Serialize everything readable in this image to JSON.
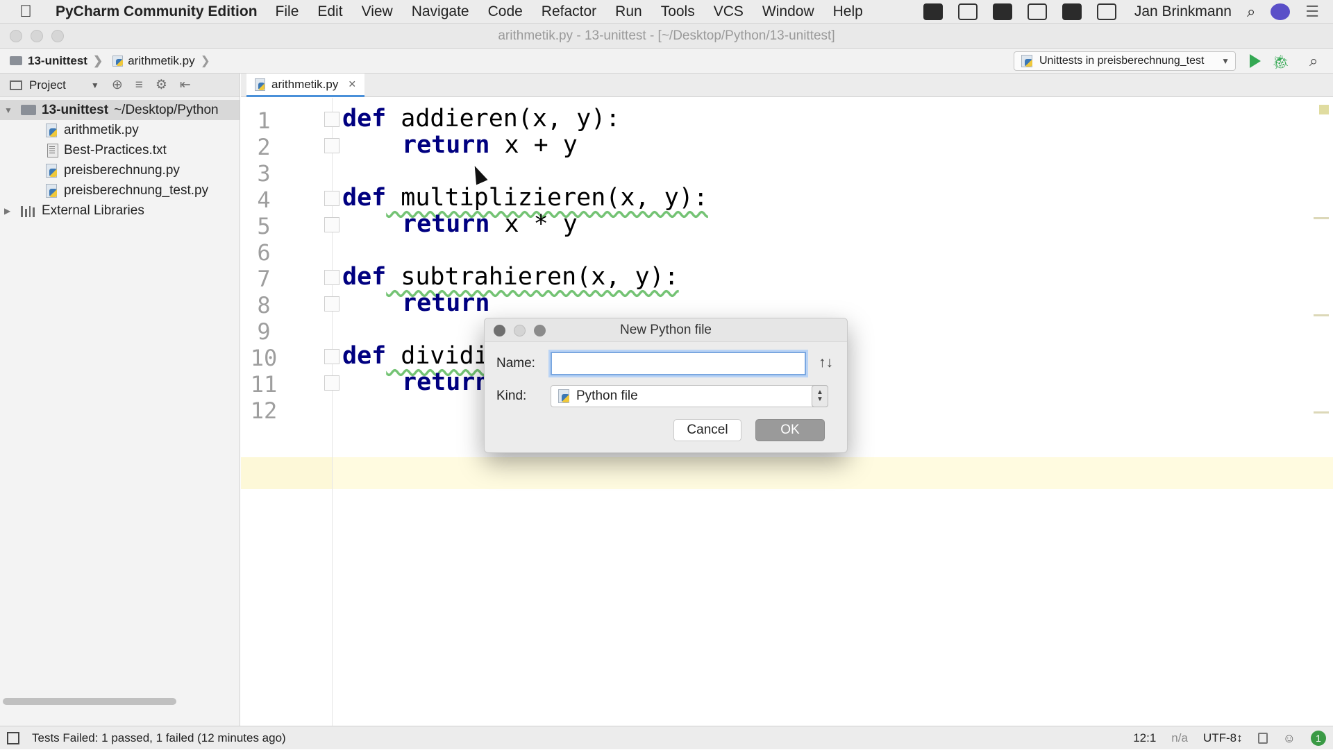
{
  "menubar": {
    "app_name": "PyCharm Community Edition",
    "items": [
      "File",
      "Edit",
      "View",
      "Navigate",
      "Code",
      "Refactor",
      "Run",
      "Tools",
      "VCS",
      "Window",
      "Help"
    ],
    "user": "Jan Brinkmann"
  },
  "window": {
    "title": "arithmetik.py - 13-unittest - [~/Desktop/Python/13-unittest]"
  },
  "navbar": {
    "breadcrumb_project": "13-unittest",
    "breadcrumb_file": "arithmetik.py",
    "run_config": "Unittests in preisberechnung_test"
  },
  "project_panel": {
    "header": "Project",
    "root_name": "13-unittest",
    "root_path": "~/Desktop/Python",
    "files": [
      "arithmetik.py",
      "Best-Practices.txt",
      "preisberechnung.py",
      "preisberechnung_test.py"
    ],
    "external": "External Libraries"
  },
  "editor": {
    "tab_label": "arithmetik.py",
    "line_numbers": [
      "1",
      "2",
      "3",
      "4",
      "5",
      "6",
      "7",
      "8",
      "9",
      "10",
      "11",
      "12"
    ],
    "lines": {
      "l1_kw": "def",
      "l1_rest": " addieren(x, y):",
      "l2_kw": "return",
      "l2_rest": " x + y",
      "l4_kw": "def",
      "l4_rest": " multiplizieren(x, y):",
      "l5_kw": "return",
      "l5_rest": " x * y",
      "l7_kw": "def",
      "l7_rest": " subtrahieren(x, y):",
      "l8_kw": "return",
      "l10_kw": "def",
      "l10_rest": " dividi",
      "l11_kw": "return"
    }
  },
  "dialog": {
    "title": "New Python file",
    "name_label": "Name:",
    "name_value": "",
    "kind_label": "Kind:",
    "kind_value": "Python file",
    "cancel": "Cancel",
    "ok": "OK"
  },
  "statusbar": {
    "message": "Tests Failed: 1 passed, 1 failed (12 minutes ago)",
    "position": "12:1",
    "na": "n/a",
    "encoding": "UTF-8↕",
    "badge_count": "1"
  },
  "colors": {
    "keyword": "#000080",
    "current_line": "#fffbe0",
    "run_green": "#34a853"
  }
}
